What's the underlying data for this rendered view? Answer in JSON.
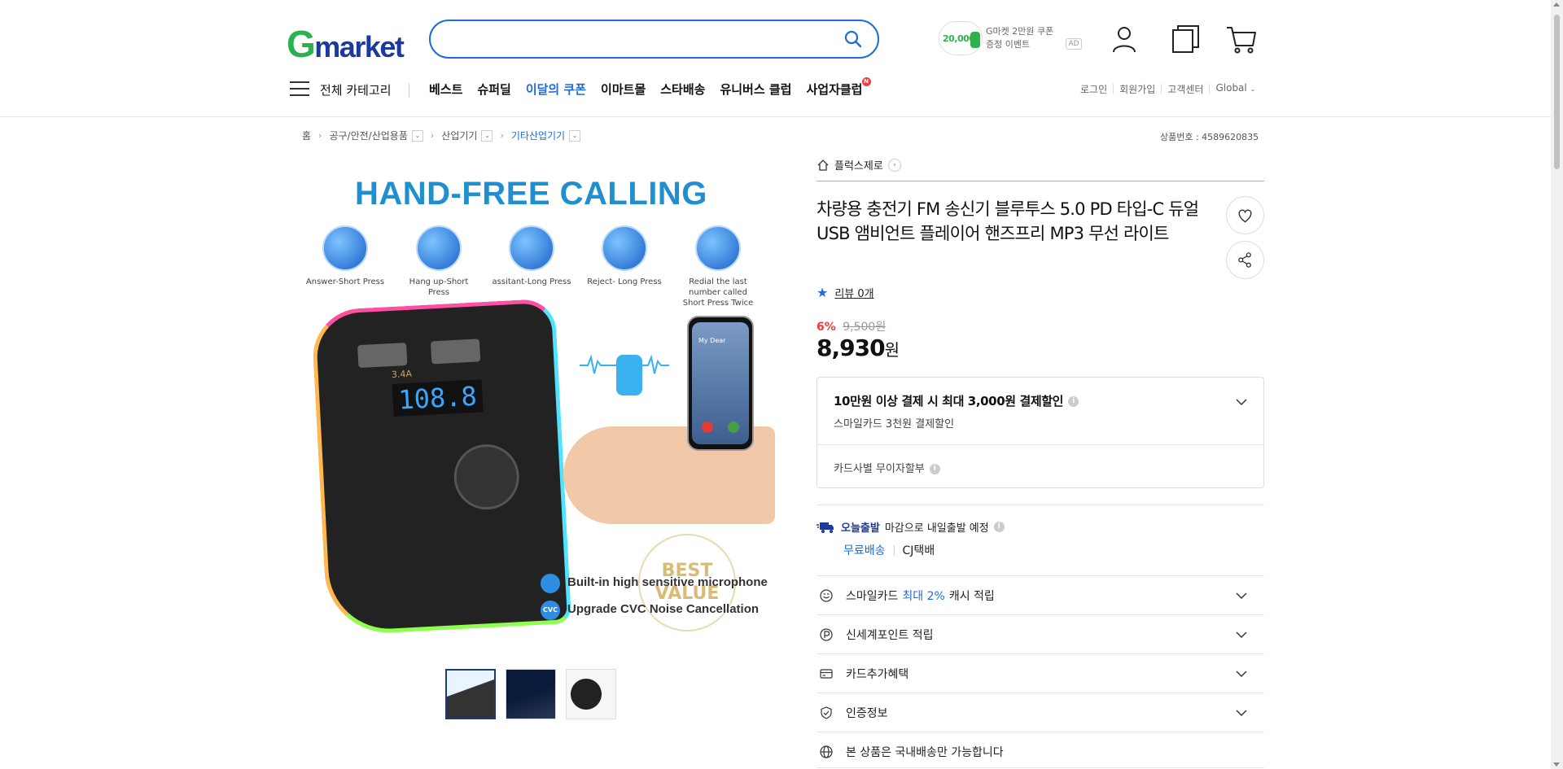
{
  "header": {
    "logo_g": "G",
    "logo_rest": "market",
    "search": {
      "placeholder": "",
      "value": ""
    },
    "coupon_ad": {
      "amount": "20,000",
      "line1": "G마켓 2만원 쿠폰",
      "line2": "증정 이벤트",
      "badge": "AD"
    },
    "icons": [
      "user-icon",
      "recent-view-icon",
      "cart-icon"
    ]
  },
  "nav": {
    "all_categories": "전체 카테고리",
    "items": [
      {
        "label": "베스트"
      },
      {
        "label": "슈퍼딜"
      },
      {
        "label": "이달의 쿠폰"
      },
      {
        "label": "이마트몰"
      },
      {
        "label": "스타배송"
      },
      {
        "label": "유니버스 클럽"
      },
      {
        "label": "사업자클럽",
        "badge": "N"
      }
    ],
    "util_links": [
      "로그인",
      "회원가입",
      "고객센터",
      "Global"
    ]
  },
  "breadcrumb": {
    "home": "홈",
    "items": [
      "공구/안전/산업용품",
      "산업기기",
      "기타산업기기"
    ]
  },
  "product_no": "상품번호 : 4589620835",
  "image": {
    "title": "HAND-FREE CALLING",
    "buttons": [
      {
        "label": "Answer-Short Press"
      },
      {
        "label": "Hang up-Short Press"
      },
      {
        "label": "assitant-Long Press"
      },
      {
        "label": "Reject- Long Press"
      },
      {
        "label": "Redial the last number called Short Press Twice"
      }
    ],
    "screen": "108.8",
    "usb_label": "3.4A",
    "phone_name": "My Dear",
    "best_value": "BEST VALUE",
    "features": [
      "Built-in high sensitive microphone",
      "Upgrade CVC Noise Cancellation"
    ],
    "feature_badge_2": "CVC",
    "thumbnails": 3
  },
  "product": {
    "shop": "플럭스제로",
    "title": "차량용 충전기 FM 송신기 블루투스 5.0 PD 타입-C 듀얼 USB 앰비언트 플레이어 핸즈프리 MP3 무선 라이트",
    "review": "리뷰 0개",
    "discount_rate": "6%",
    "original_price": "9,500원",
    "price": "8,930",
    "price_unit": "원"
  },
  "benefit": {
    "main": "10만원 이상 결제 시 최대 3,000원 결제할인",
    "sub": "스마일카드 3천원 결제할인",
    "installment": "카드사별 무이자할부"
  },
  "shipping": {
    "today": "오늘출발",
    "desc": "마감으로 내일출발 예정",
    "free": "무료배송",
    "carrier": "CJ택배"
  },
  "rows": [
    {
      "pre": "스마일카드",
      "blue": "최대 2%",
      "post": "캐시 적립"
    },
    {
      "pre": "신세계포인트 적립"
    },
    {
      "pre": "카드추가혜택"
    },
    {
      "pre": "인증정보"
    },
    {
      "pre": "본 상품은 국내배송만 가능합니다"
    }
  ],
  "colors": {
    "brand_green": "#2bb24c",
    "brand_blue": "#1f6bd8",
    "discount_red": "#f23b3b"
  }
}
